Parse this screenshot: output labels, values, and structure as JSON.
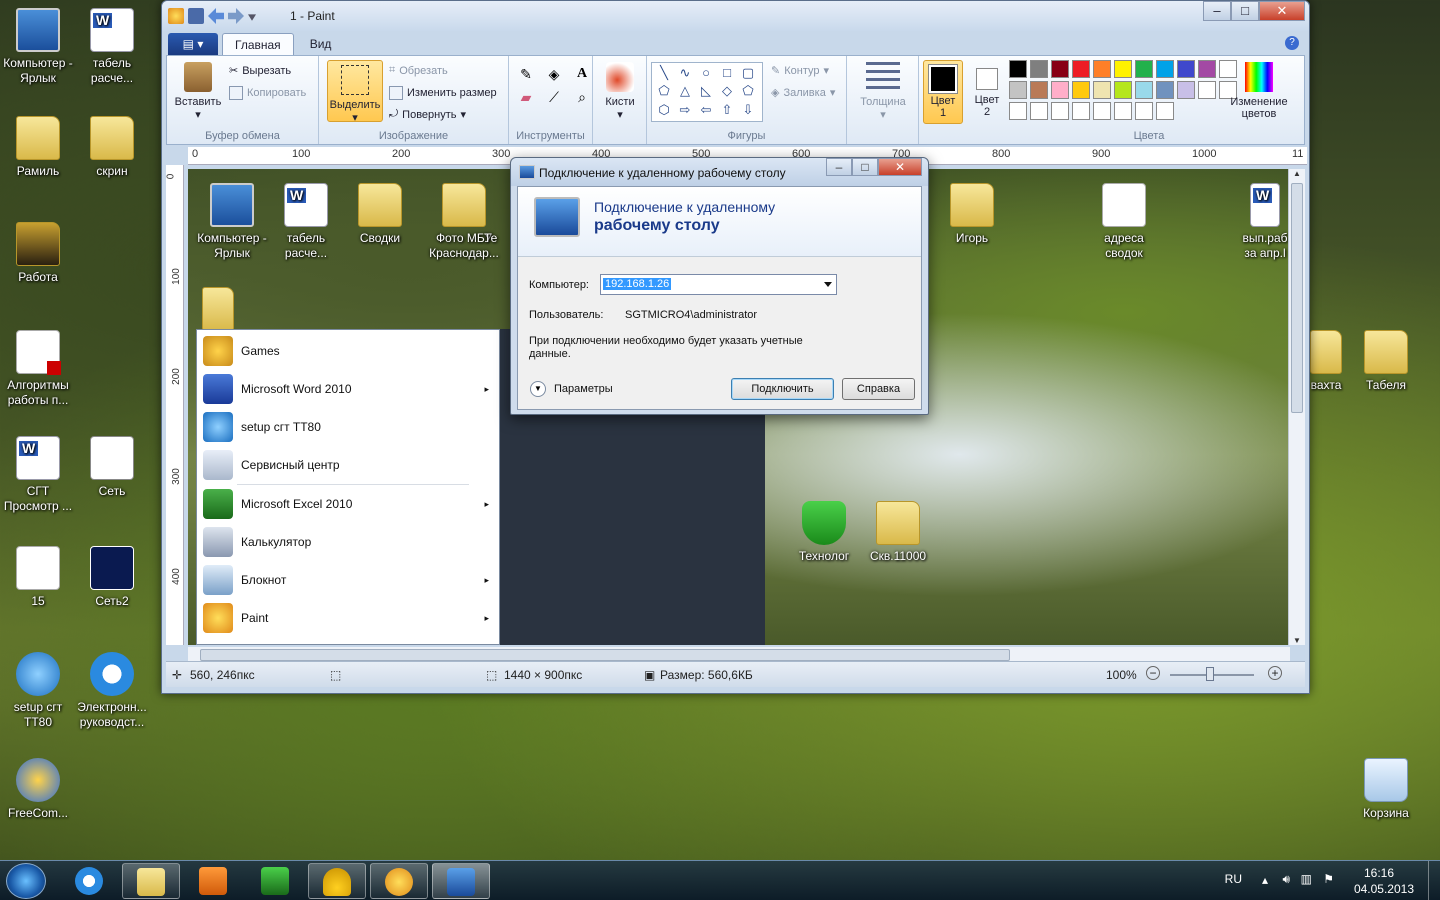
{
  "desktop": {
    "icons_left": [
      {
        "label": "Компьютер - Ярлык",
        "icon": "computer-icon"
      },
      {
        "label": "табель расче...",
        "icon": "word-document-icon"
      },
      {
        "label": "Рамиль",
        "icon": "folder-icon"
      },
      {
        "label": "скрин",
        "icon": "folder-icon"
      },
      {
        "label": "Работа",
        "icon": "folder-icon"
      },
      {
        "label": "Алгоритмы работы п...",
        "icon": "pdf-icon"
      },
      {
        "label": "СГТ Просмотр ...",
        "icon": "word-document-icon"
      },
      {
        "label": "Сеть",
        "icon": "network-icon"
      },
      {
        "label": "15",
        "icon": "blank-document-icon"
      },
      {
        "label": "Сеть2",
        "icon": "network-icon"
      },
      {
        "label": "setup сгт TT80",
        "icon": "setup-icon"
      },
      {
        "label": "Электронн... руководст...",
        "icon": "internet-explorer-icon"
      },
      {
        "label": "FreeCom...",
        "icon": "app-icon"
      }
    ],
    "icons_right": [
      {
        "label": "вахта",
        "icon": "folder-icon"
      },
      {
        "label": "Табеля",
        "icon": "folder-icon"
      },
      {
        "label": "Корзина",
        "icon": "recycle-bin-icon"
      }
    ]
  },
  "paint": {
    "title": "1 - Paint",
    "controls": {
      "minimize": "‒",
      "maximize": "□",
      "close": "✕"
    },
    "tabs": {
      "home": "Главная",
      "view": "Вид"
    },
    "help": "?",
    "ribbon": {
      "clipboard": {
        "paste": "Вставить",
        "cut": "Вырезать",
        "copy": "Копировать",
        "group": "Буфер обмена"
      },
      "image": {
        "select": "Выделить",
        "crop": "Обрезать",
        "resize": "Изменить размер",
        "rotate": "Повернуть",
        "group": "Изображение"
      },
      "tools": {
        "group": "Инструменты",
        "text_tool": "A"
      },
      "brushes": {
        "label": "Кисти"
      },
      "shapes": {
        "outline": "Контур",
        "fill": "Заливка",
        "group": "Фигуры"
      },
      "size": {
        "label": "Толщина"
      },
      "color1": {
        "label": "Цвет",
        "num": "1"
      },
      "color2": {
        "label": "Цвет",
        "num": "2"
      },
      "edit_colors": {
        "label1": "Изменение",
        "label2": "цветов"
      },
      "colors_group": "Цвета",
      "palette": [
        "#000000",
        "#7f7f7f",
        "#880015",
        "#ed1c24",
        "#ff7f27",
        "#fff200",
        "#22b14c",
        "#00a2e8",
        "#3f48cc",
        "#a349a4",
        "#ffffff",
        "#c3c3c3",
        "#b97a57",
        "#ffaec9",
        "#ffc90e",
        "#efe4b0",
        "#b5e61d",
        "#99d9ea",
        "#7092be",
        "#c8bfe7",
        "#ffffff",
        "#ffffff",
        "#ffffff",
        "#ffffff",
        "#ffffff",
        "#ffffff",
        "#ffffff",
        "#ffffff",
        "#ffffff",
        "#ffffff"
      ]
    },
    "ruler_h": [
      "0",
      "100",
      "200",
      "300",
      "400",
      "500",
      "600",
      "700",
      "800",
      "900",
      "1000",
      "11"
    ],
    "ruler_v": [
      "0",
      "100",
      "200",
      "300",
      "400"
    ],
    "canvas": {
      "icons": [
        {
          "label": "Компьютер - Ярлык"
        },
        {
          "label": "табель расче..."
        },
        {
          "label": "Сводки"
        },
        {
          "label": "Фото МБУ Краснодар..."
        },
        {
          "label": "Те"
        },
        {
          "label": "Игорь"
        },
        {
          "label": "адреса сводок"
        },
        {
          "label": "вып.раб за апр.l"
        },
        {
          "label": "Технолог"
        },
        {
          "label": "Скв.11000"
        }
      ],
      "start_menu": [
        {
          "label": "Games",
          "icon": "games-icon",
          "arrow": false
        },
        {
          "label": "Microsoft Word 2010",
          "icon": "word-icon",
          "arrow": true
        },
        {
          "label": "setup сгт TT80",
          "icon": "setup-icon",
          "arrow": false
        },
        {
          "label": "Сервисный центр",
          "icon": "service-icon",
          "arrow": false
        },
        {
          "label": "Microsoft Excel 2010",
          "icon": "excel-icon",
          "arrow": true
        },
        {
          "label": "Калькулятор",
          "icon": "calculator-icon",
          "arrow": false
        },
        {
          "label": "Блокнот",
          "icon": "notepad-icon",
          "arrow": true
        },
        {
          "label": "Paint",
          "icon": "paint-icon",
          "arrow": true
        }
      ],
      "arrow_glyph": "▸"
    },
    "status": {
      "position": "560, 246пкс",
      "dimensions": "1440 × 900пкс",
      "size": "Размер: 560,6КБ",
      "zoom": "100%"
    }
  },
  "rdp": {
    "title": "Подключение к удаленному рабочему столу",
    "banner_line1": "Подключение к удаленному",
    "banner_line2": "рабочему столу",
    "computer_label": "Компьютер:",
    "computer_value": "192.168.1.26",
    "user_label": "Пользователь:",
    "user_value": "SGTMICRO4\\administrator",
    "note": "При подключении необходимо будет указать учетные данные.",
    "options": "Параметры",
    "connect": "Подключить",
    "help": "Справка"
  },
  "taskbar": {
    "lang": "RU",
    "time": "16:16",
    "date": "04.05.2013"
  }
}
